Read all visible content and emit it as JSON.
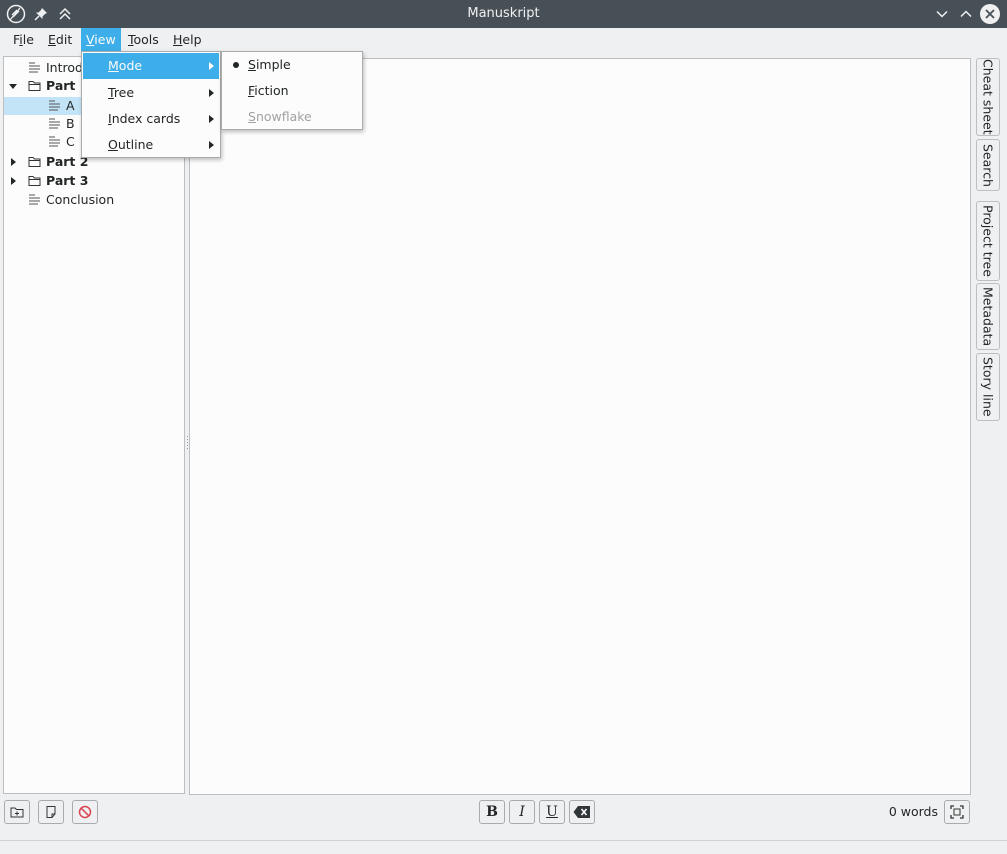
{
  "window": {
    "title": "Manuskript"
  },
  "menubar": [
    {
      "label": "File",
      "mnemonic": "i",
      "pre": "F",
      "post": "le"
    },
    {
      "label": "Edit",
      "mnemonic": "E",
      "pre": "",
      "post": "dit"
    },
    {
      "label": "View",
      "mnemonic": "V",
      "pre": "",
      "post": "iew"
    },
    {
      "label": "Tools",
      "mnemonic": "T",
      "pre": "",
      "post": "ools"
    },
    {
      "label": "Help",
      "mnemonic": "H",
      "pre": "",
      "post": "elp"
    }
  ],
  "view_menu": [
    {
      "label": "Mode",
      "mnemonic": "M",
      "rest": "ode",
      "highlighted": true
    },
    {
      "label": "Tree",
      "mnemonic": "T",
      "rest": "ree"
    },
    {
      "label": "Index cards",
      "mnemonic": "I",
      "rest": "ndex cards"
    },
    {
      "label": "Outline",
      "mnemonic": "O",
      "rest": "utline"
    }
  ],
  "mode_menu": [
    {
      "label": "Simple",
      "mnemonic": "S",
      "rest": "imple",
      "checked": true
    },
    {
      "label": "Fiction",
      "mnemonic": "F",
      "rest": "iction"
    },
    {
      "label": "Snowflake",
      "mnemonic": "S",
      "rest": "nowflake",
      "disabled": true
    }
  ],
  "tree": [
    {
      "label": "Introduction",
      "visible_label": "Introd",
      "type": "text",
      "bold": false
    },
    {
      "label": "Part 1",
      "type": "folder",
      "bold": true,
      "expanded": true
    },
    {
      "label": "A",
      "type": "text",
      "selected": true
    },
    {
      "label": "B",
      "type": "text"
    },
    {
      "label": "C",
      "type": "text"
    },
    {
      "label": "Part 2",
      "type": "folder",
      "bold": true,
      "expanded": false
    },
    {
      "label": "Part 3",
      "type": "folder",
      "bold": true,
      "expanded": false
    },
    {
      "label": "Conclusion",
      "type": "text"
    }
  ],
  "dock_tabs": [
    {
      "label": "Cheat sheet"
    },
    {
      "label": "Search"
    },
    {
      "label": "Project tree"
    },
    {
      "label": "Metadata"
    },
    {
      "label": "Story line"
    }
  ],
  "format_toolbar": {
    "bold": "B",
    "italic": "I",
    "underline": "U"
  },
  "status": {
    "word_count": "0 words"
  },
  "colors": {
    "accent": "#3daee9",
    "titlebar": "#475057",
    "selection": "#c3e4f7"
  },
  "icons": [
    "app-feather-icon",
    "pin-icon",
    "keep-above-icon",
    "minimize-icon",
    "maximize-icon",
    "close-icon",
    "folder-icon",
    "text-document-icon",
    "add-folder-icon",
    "add-text-icon",
    "delete-icon",
    "clear-format-icon",
    "fullscreen-icon"
  ]
}
